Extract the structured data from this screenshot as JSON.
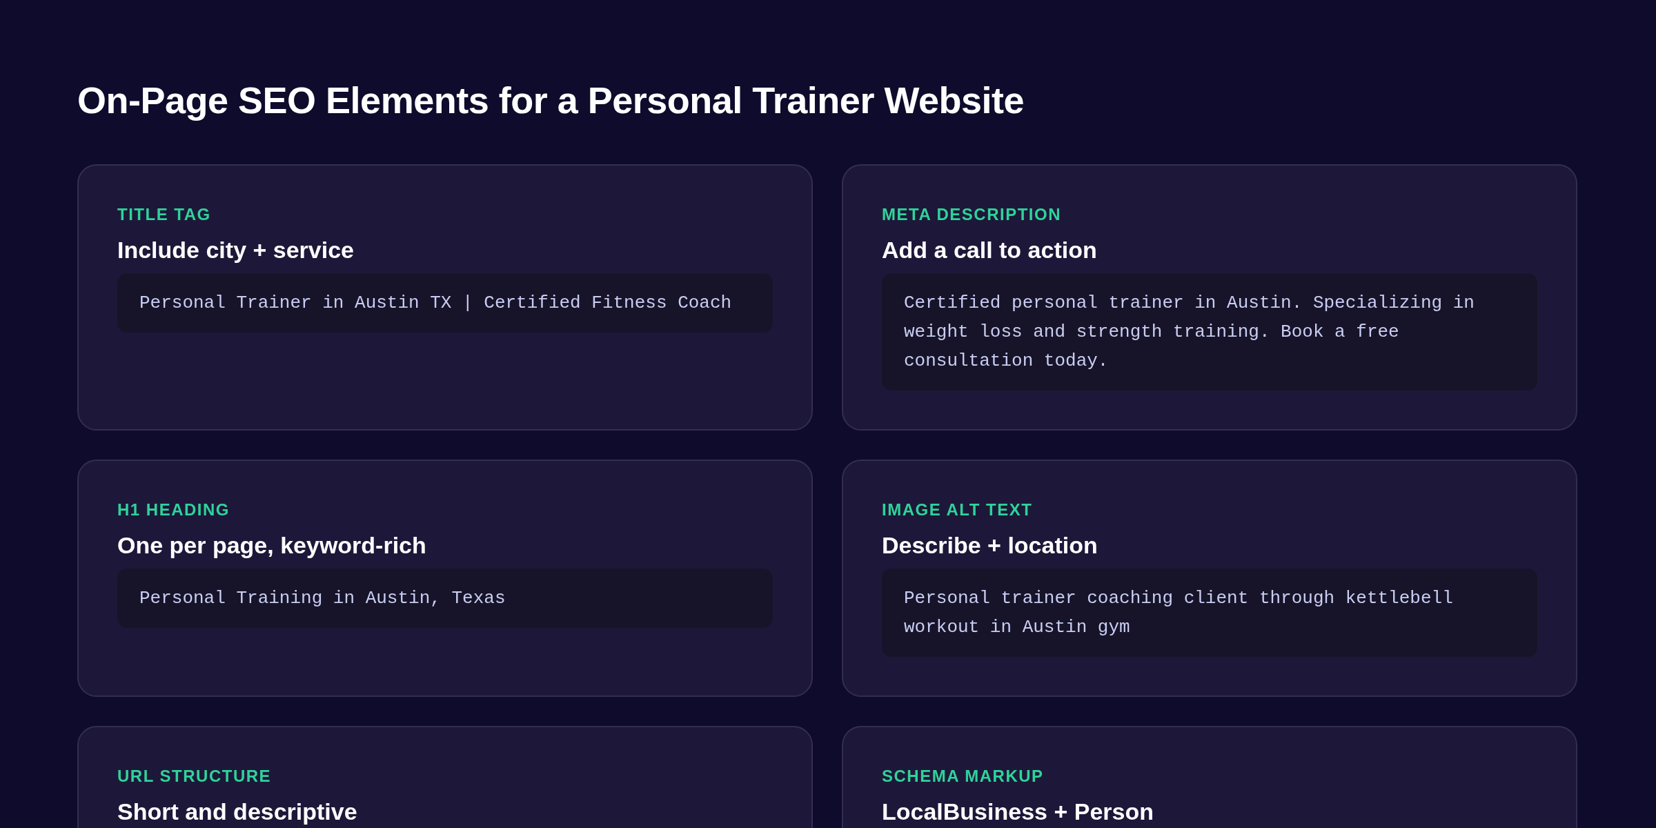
{
  "title": "On-Page SEO Elements for a Personal Trainer Website",
  "cards": [
    {
      "label": "TITLE TAG",
      "heading": "Include city + service",
      "example": "Personal Trainer in Austin TX | Certified Fitness Coach"
    },
    {
      "label": "META DESCRIPTION",
      "heading": "Add a call to action",
      "example": "Certified personal trainer in Austin. Specializing in weight loss and strength training. Book a free consultation today."
    },
    {
      "label": "H1 HEADING",
      "heading": "One per page, keyword-rich",
      "example": "Personal Training in Austin, Texas"
    },
    {
      "label": "IMAGE ALT TEXT",
      "heading": "Describe + location",
      "example": "Personal trainer coaching client through kettlebell workout in Austin gym"
    },
    {
      "label": "URL STRUCTURE",
      "heading": "Short and descriptive"
    },
    {
      "label": "SCHEMA MARKUP",
      "heading": "LocalBusiness + Person"
    }
  ]
}
